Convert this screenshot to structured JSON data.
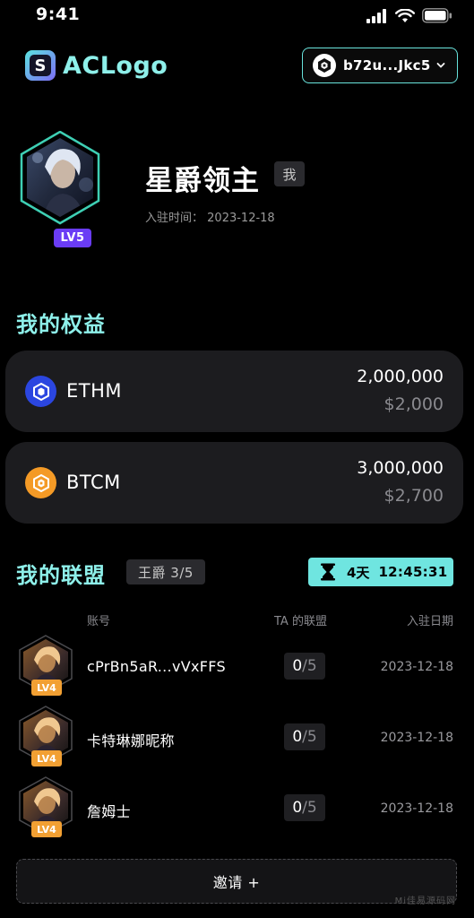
{
  "status_bar": {
    "time": "9:41"
  },
  "header": {
    "logo_mark": "S",
    "logo_text": "ACLogo",
    "wallet_address": "b72u...Jkc5"
  },
  "profile": {
    "name": "星爵领主",
    "me_tag": "我",
    "level": "LV5",
    "join_label": "入驻时间：",
    "join_date": "2023-12-18"
  },
  "benefits": {
    "title": "我的权益",
    "assets": [
      {
        "name": "ETHM",
        "amount": "2,000,000",
        "usd": "$2,000",
        "color": "#2b46e0",
        "icon": "ethm-coin-icon"
      },
      {
        "name": "BTCM",
        "amount": "3,000,000",
        "usd": "$2,700",
        "color": "#f49a26",
        "icon": "btcm-coin-icon"
      }
    ]
  },
  "alliance": {
    "title": "我的联盟",
    "rank_tag": "王爵 3/5",
    "timer_days": "4天",
    "timer_clock": "12:45:31",
    "columns": {
      "account": "账号",
      "ta_alliance": "TA 的联盟",
      "join_date": "入驻日期"
    },
    "members": [
      {
        "name": "cPrBn5aR...vVxFFS",
        "level": "LV4",
        "count_num": "0",
        "count_den": "/5",
        "date": "2023-12-18"
      },
      {
        "name": "卡特琳娜昵称",
        "level": "LV4",
        "count_num": "0",
        "count_den": "/5",
        "date": "2023-12-18"
      },
      {
        "name": "詹姆士",
        "level": "LV4",
        "count_num": "0",
        "count_den": "/5",
        "date": "2023-12-18"
      }
    ],
    "invite_label": "邀请 +"
  },
  "watermark": "Mi佳易源码网"
}
